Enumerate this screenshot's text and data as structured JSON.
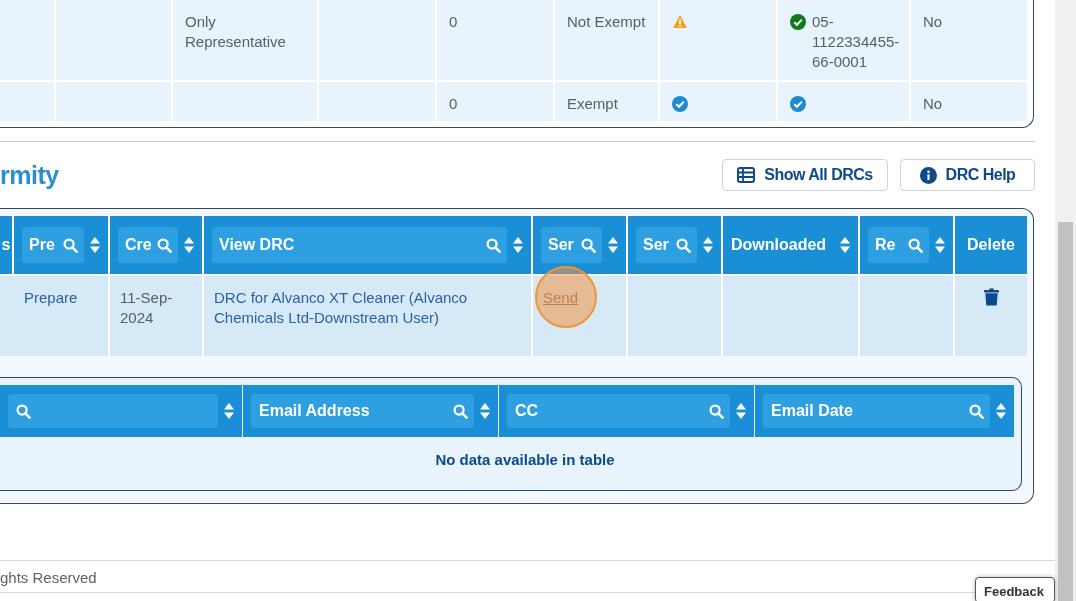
{
  "substances_table": {
    "rows": [
      {
        "cells": [
          null,
          null,
          {
            "text": "Only Representative"
          },
          null,
          {
            "text": "0"
          },
          {
            "text": "Not Exempt"
          },
          {
            "kind": "warning"
          },
          {
            "kind": "check",
            "color": "#0e7a1c",
            "text": "05-1122334455-66-0001"
          },
          {
            "text": "No"
          }
        ]
      },
      {
        "cells": [
          null,
          null,
          null,
          null,
          {
            "text": "0"
          },
          {
            "text": "Exempt"
          },
          {
            "kind": "check",
            "color": "#1f8ad2"
          },
          {
            "kind": "check",
            "color": "#1f8ad2"
          },
          {
            "text": "No"
          }
        ]
      }
    ]
  },
  "section": {
    "title": "rmity",
    "buttons": [
      {
        "kind": "list",
        "label": "Show All DRCs"
      },
      {
        "kind": "info",
        "label": "DRC Help"
      }
    ]
  },
  "drc_table": {
    "columns": [
      {
        "label": "s",
        "searchable": false,
        "sortable": false
      },
      {
        "label": "Pre",
        "searchable": true,
        "sortable": true
      },
      {
        "label": "Cre",
        "searchable": true,
        "sortable": true
      },
      {
        "label": "View DRC",
        "searchable": true,
        "sortable": true
      },
      {
        "label": "Ser",
        "searchable": true,
        "sortable": true
      },
      {
        "label": "Ser",
        "searchable": true,
        "sortable": true
      },
      {
        "label": "Downloaded",
        "searchable": false,
        "sortable": true
      },
      {
        "label": "Re",
        "searchable": true,
        "sortable": true
      },
      {
        "label": "Delete",
        "searchable": false,
        "sortable": false
      }
    ],
    "rows": [
      {
        "cells": [
          null,
          {
            "kind": "link",
            "text": "Prepare"
          },
          {
            "kind": "text",
            "text": "11-Sep-2024"
          },
          {
            "kind": "link",
            "text": "DRC for Alvanco XT Cleaner (Alvanco Chemicals Ltd-Downstream User)"
          },
          {
            "kind": "action",
            "text": "Send",
            "highlighted": true
          },
          null,
          null,
          null,
          {
            "kind": "delete"
          }
        ]
      }
    ]
  },
  "email_table": {
    "columns": [
      {
        "searchable": true,
        "sortable": true
      },
      {
        "label": "Email Address",
        "searchable": true,
        "sortable": true
      },
      {
        "label": "CC",
        "searchable": true,
        "sortable": true
      },
      {
        "label": "Email Date",
        "searchable": true,
        "sortable": true
      }
    ],
    "empty_message": "No data available in table"
  },
  "footer": {
    "text": "ghts Reserved"
  },
  "feedback_tab": {
    "label": "Feedback"
  }
}
